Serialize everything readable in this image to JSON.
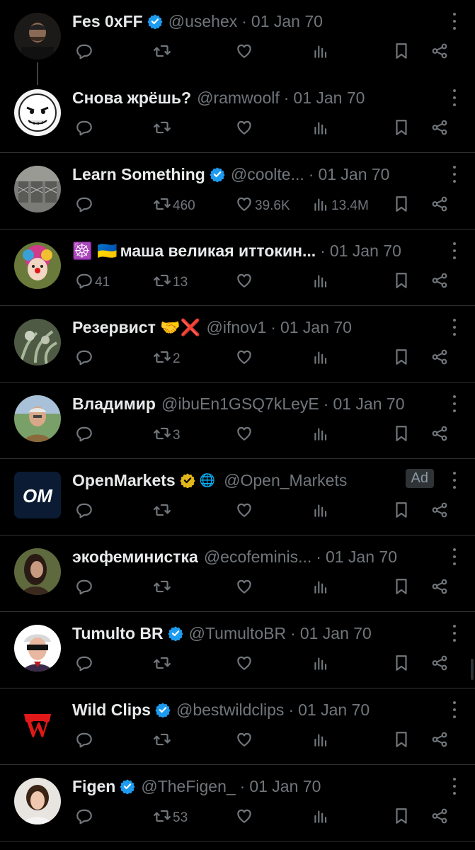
{
  "tweets": [
    {
      "name": "Fes 0xFF",
      "badge": "blue",
      "handle": "@usehex",
      "dot": "·",
      "date": "01 Jan 70",
      "reply": "",
      "retweet": "",
      "like": "",
      "views": "",
      "avatar": "dark-man",
      "thread": true,
      "ad": ""
    },
    {
      "name": "Снова жрёшь?",
      "badge": "",
      "handle": "@ramwoolf",
      "dot": "·",
      "date": "01 Jan 70",
      "reply": "",
      "retweet": "",
      "like": "",
      "views": "",
      "avatar": "meme-face",
      "thread": false,
      "ad": ""
    },
    {
      "name": "Learn Something",
      "badge": "blue",
      "handle": "@coolte...",
      "dot": "·",
      "date": "01 Jan 70",
      "reply": "",
      "retweet": "460",
      "like": "39.6K",
      "views": "13.4M",
      "avatar": "gabions",
      "thread": false,
      "ad": ""
    },
    {
      "name": "маша великая иттокин...",
      "prefix": "☸️ 🇺🇦",
      "badge": "",
      "handle": "",
      "dot": "·",
      "date": "01 Jan 70",
      "reply": "41",
      "retweet": "13",
      "like": "",
      "views": "",
      "avatar": "clown",
      "thread": false,
      "ad": ""
    },
    {
      "name": "Резервист 🤝❌",
      "badge": "",
      "handle": "@ifnov1",
      "dot": "·",
      "date": "01 Jan 70",
      "reply": "",
      "retweet": "2",
      "like": "",
      "views": "",
      "avatar": "plants",
      "thread": false,
      "ad": ""
    },
    {
      "name": "Владимир",
      "badge": "",
      "handle": "@ibuEn1GSQ7kLeyE",
      "dot": "·",
      "date": "01 Jan 70",
      "reply": "",
      "retweet": "3",
      "like": "",
      "views": "",
      "avatar": "old-man",
      "thread": false,
      "ad": ""
    },
    {
      "name": "OpenMarkets",
      "badge": "gold",
      "handle": "@Open_Markets",
      "dot": "",
      "date": "",
      "reply": "",
      "retweet": "",
      "like": "",
      "views": "",
      "avatar": "om-logo",
      "logo_text": "OM",
      "thread": false,
      "ad": "Ad"
    },
    {
      "name": "экофеминистка",
      "badge": "",
      "handle": "@ecofeminis...",
      "dot": "·",
      "date": "01 Jan 70",
      "reply": "",
      "retweet": "",
      "like": "",
      "views": "",
      "avatar": "woman-dark",
      "thread": false,
      "ad": ""
    },
    {
      "name": "Tumulto BR",
      "badge": "blue",
      "handle": "@TumultoBR",
      "dot": "·",
      "date": "01 Jan 70",
      "reply": "",
      "retweet": "",
      "like": "",
      "views": "",
      "avatar": "sunglasses",
      "thread": false,
      "ad": ""
    },
    {
      "name": "Wild Clips",
      "badge": "blue",
      "handle": "@bestwildclips",
      "dot": "·",
      "date": "01 Jan 70",
      "reply": "",
      "retweet": "",
      "like": "",
      "views": "",
      "avatar": "w-logo",
      "logo_text": "W",
      "thread": false,
      "ad": ""
    },
    {
      "name": "Figen",
      "badge": "blue",
      "handle": "@TheFigen_",
      "dot": "·",
      "date": "01 Jan 70",
      "reply": "",
      "retweet": "53",
      "like": "",
      "views": "",
      "avatar": "woman-light",
      "thread": false,
      "ad": ""
    }
  ],
  "colors": {
    "background": "#000000",
    "text": "#e7e9ea",
    "muted": "#71767b",
    "verified_blue": "#1d9bf0",
    "verified_gold": "#e2b719",
    "divider": "#2f3336"
  },
  "icons": [
    "reply-icon",
    "retweet-icon",
    "like-icon",
    "views-icon",
    "bookmark-icon",
    "share-icon",
    "more-icon",
    "verified-badge-icon"
  ]
}
